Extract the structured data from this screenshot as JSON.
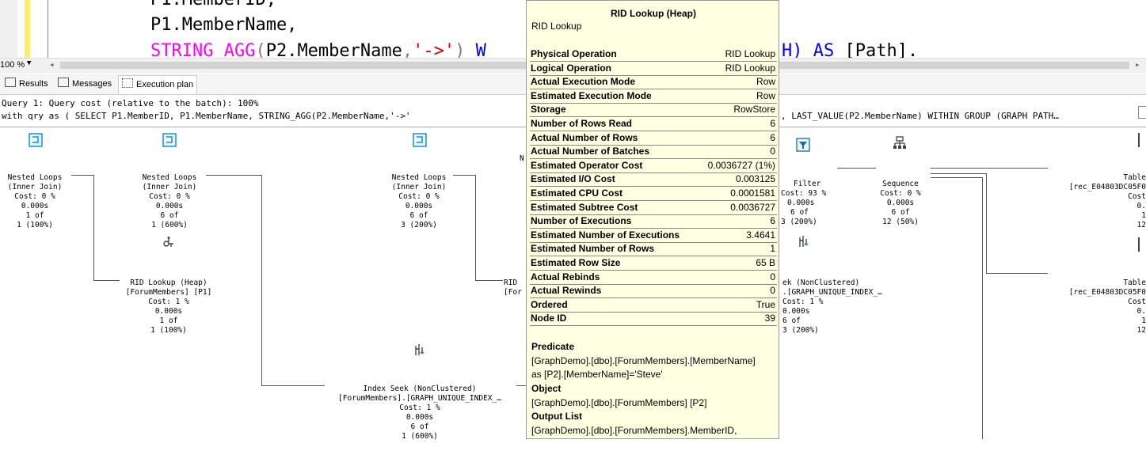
{
  "editor": {
    "line1_code": "P1.MemberID,",
    "line2_code": "P1.MemberName,",
    "line3_func": "STRING_AGG",
    "line3_paren_open": "(",
    "line3_arg": "P2.MemberName",
    "line3_comma": ",",
    "line3_str": "'->'",
    "line3_close": ")",
    "line3_w": "W",
    "line3_tail_h": "H)",
    "line3_as": "AS",
    "line3_path": "[Path]."
  },
  "scrollbar": {
    "zoom": "100 %"
  },
  "tabs": {
    "results": "Results",
    "messages": "Messages",
    "execution_plan": "Execution plan"
  },
  "query": {
    "cost_line": "Query 1: Query cost (relative to the batch): 100%",
    "sql_line_left": "with qry as ( SELECT P1.MemberID, P1.MemberName, STRING_AGG(P2.MemberName,'->'",
    "sql_line_right": ", LAST_VALUE(P2.MemberName) WITHIN GROUP (GRAPH PATH…"
  },
  "plan": {
    "nl1": {
      "title": "Nested Loops",
      "sub": "(Inner Join)",
      "cost": "Cost: 0 %",
      "time": "0.000s",
      "rows": "1 of",
      "pct": "1 (100%)"
    },
    "nl2": {
      "title": "Nested Loops",
      "sub": "(Inner Join)",
      "cost": "Cost: 0 %",
      "time": "0.000s",
      "rows": "6 of",
      "pct": "1 (600%)"
    },
    "nl3": {
      "title": "Nested Loops",
      "sub": "(Inner Join)",
      "cost": "Cost: 0 %",
      "time": "0.000s",
      "rows": "6 of",
      "pct": "3 (200%)"
    },
    "rid1": {
      "title": "RID Lookup (Heap)",
      "sub": "[ForumMembers] [P1]",
      "cost": "Cost: 1 %",
      "time": "0.000s",
      "rows": "1 of",
      "pct": "1 (100%)"
    },
    "rid2": {
      "title": "RID",
      "sub": "[For"
    },
    "seek1": {
      "title": "Index Seek (NonClustered)",
      "sub": "[ForumMembers].[GRAPH_UNIQUE_INDEX_…",
      "cost": "Cost: 1 %",
      "time": "0.000s",
      "rows": "6 of",
      "pct": "1 (600%)"
    },
    "seek2": {
      "title": "ek (NonClustered)",
      "sub": ".[GRAPH_UNIQUE_INDEX_…",
      "cost": "Cost: 1 %",
      "time": "0.000s",
      "rows": "6 of",
      "pct": "3 (200%)"
    },
    "filter": {
      "title": "Filter",
      "cost": "Cost: 93 %",
      "time": "0.000s",
      "rows": "6 of",
      "pct": "3 (200%)"
    },
    "sequence": {
      "title": "Sequence",
      "cost": "Cost: 0 %",
      "time": "0.000s",
      "rows": "6 of",
      "pct": "12 (50%)"
    },
    "table1": {
      "title": "Table",
      "sub": "[rec_E04803DC05F0",
      "cost": "Cost",
      "time": "0.",
      "rows": "1",
      "pct": "12"
    },
    "table2": {
      "title": "Table",
      "sub": "[rec_E04803DC05F0",
      "cost": "Cost",
      "time": "0.",
      "rows": "1",
      "pct": "12"
    }
  },
  "tooltip": {
    "title": "RID Lookup (Heap)",
    "subtitle": "RID Lookup",
    "properties": [
      {
        "k": "Physical Operation",
        "v": "RID Lookup"
      },
      {
        "k": "Logical Operation",
        "v": "RID Lookup"
      },
      {
        "k": "Actual Execution Mode",
        "v": "Row"
      },
      {
        "k": "Estimated Execution Mode",
        "v": "Row"
      },
      {
        "k": "Storage",
        "v": "RowStore"
      },
      {
        "k": "Number of Rows Read",
        "v": "6"
      },
      {
        "k": "Actual Number of Rows",
        "v": "6"
      },
      {
        "k": "Actual Number of Batches",
        "v": "0"
      },
      {
        "k": "Estimated Operator Cost",
        "v": "0.0036727 (1%)"
      },
      {
        "k": "Estimated I/O Cost",
        "v": "0.003125"
      },
      {
        "k": "Estimated CPU Cost",
        "v": "0.0001581"
      },
      {
        "k": "Estimated Subtree Cost",
        "v": "0.0036727"
      },
      {
        "k": "Number of Executions",
        "v": "6"
      },
      {
        "k": "Estimated Number of Executions",
        "v": "3.4641"
      },
      {
        "k": "Estimated Number of Rows",
        "v": "1"
      },
      {
        "k": "Estimated Row Size",
        "v": "65 B"
      },
      {
        "k": "Actual Rebinds",
        "v": "0"
      },
      {
        "k": "Actual Rewinds",
        "v": "0"
      },
      {
        "k": "Ordered",
        "v": "True"
      },
      {
        "k": "Node ID",
        "v": "39"
      }
    ],
    "predicate_label": "Predicate",
    "predicate_line1": "[GraphDemo].[dbo].[ForumMembers].[MemberName]",
    "predicate_line2": "as [P2].[MemberName]='Steve'",
    "object_label": "Object",
    "object_value": "[GraphDemo].[dbo].[ForumMembers] [P2]",
    "output_label": "Output List",
    "output_value": "[GraphDemo].[dbo].[ForumMembers].MemberID,"
  }
}
